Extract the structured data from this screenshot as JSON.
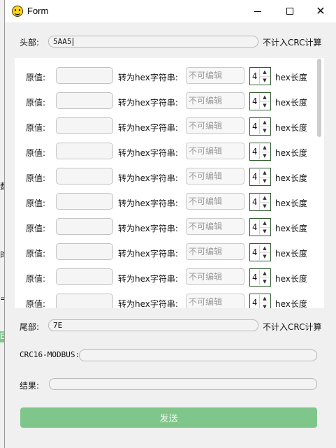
{
  "window": {
    "title": "Form"
  },
  "background_fragments": [
    "数",
    "时",
    "=:",
    "E"
  ],
  "header": {
    "label": "头部:",
    "value": "5AA5",
    "note": "不计入CRC计算"
  },
  "rows": [
    {
      "label": "原值:",
      "value": "",
      "convert_label": "转为hex字符串:",
      "hex_placeholder": "不可编辑",
      "length": "4",
      "length_label": "hex长度"
    },
    {
      "label": "原值:",
      "value": "",
      "convert_label": "转为hex字符串:",
      "hex_placeholder": "不可编辑",
      "length": "4",
      "length_label": "hex长度"
    },
    {
      "label": "原值:",
      "value": "",
      "convert_label": "转为hex字符串:",
      "hex_placeholder": "不可编辑",
      "length": "4",
      "length_label": "hex长度"
    },
    {
      "label": "原值:",
      "value": "",
      "convert_label": "转为hex字符串:",
      "hex_placeholder": "不可编辑",
      "length": "4",
      "length_label": "hex长度"
    },
    {
      "label": "原值:",
      "value": "",
      "convert_label": "转为hex字符串:",
      "hex_placeholder": "不可编辑",
      "length": "4",
      "length_label": "hex长度"
    },
    {
      "label": "原值:",
      "value": "",
      "convert_label": "转为hex字符串:",
      "hex_placeholder": "不可编辑",
      "length": "4",
      "length_label": "hex长度"
    },
    {
      "label": "原值:",
      "value": "",
      "convert_label": "转为hex字符串:",
      "hex_placeholder": "不可编辑",
      "length": "4",
      "length_label": "hex长度"
    },
    {
      "label": "原值:",
      "value": "",
      "convert_label": "转为hex字符串:",
      "hex_placeholder": "不可编辑",
      "length": "4",
      "length_label": "hex长度"
    },
    {
      "label": "原值:",
      "value": "",
      "convert_label": "转为hex字符串:",
      "hex_placeholder": "不可编辑",
      "length": "4",
      "length_label": "hex长度"
    },
    {
      "label": "原值:",
      "value": "",
      "convert_label": "转为hex字符串:",
      "hex_placeholder": "不可编辑",
      "length": "4",
      "length_label": "hex长度"
    }
  ],
  "tail": {
    "label": "尾部:",
    "value": "7E",
    "note": "不计入CRC计算"
  },
  "crc": {
    "label": "CRC16-MODBUS:",
    "value": ""
  },
  "result": {
    "label": "结果:",
    "value": ""
  },
  "send": {
    "label": "发送",
    "color": "#7fc68a"
  },
  "icons": {
    "app": "smiley-icon",
    "minimize": "minimize-icon",
    "maximize": "maximize-icon",
    "close": "close-icon"
  }
}
